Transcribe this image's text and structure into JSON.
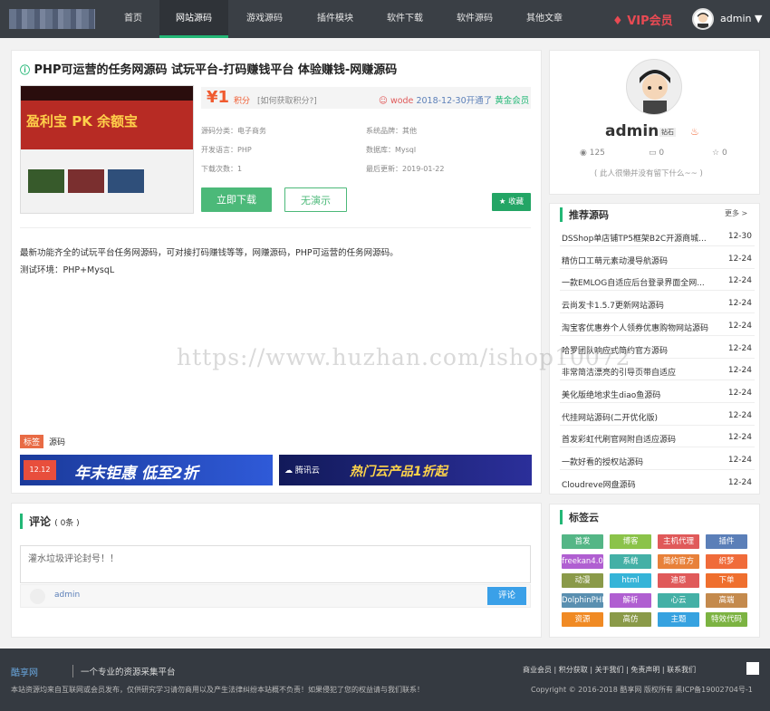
{
  "nav": {
    "items": [
      "首页",
      "网站源码",
      "游戏源码",
      "插件模块",
      "软件下载",
      "软件源码",
      "其他文章"
    ],
    "vip": "VIP会员",
    "user": "admin"
  },
  "product": {
    "title": "PHP可运营的任务网源码 试玩平台-打码赚钱平台 体验赚钱-网赚源码",
    "price": "¥1",
    "price_unit": "积分",
    "price_hint": "[如何获取积分?]",
    "vip_user": "wode",
    "vip_date": "2018-12-30开通了",
    "vip_level": "黄金会员",
    "meta": {
      "category": "源码分类：电子商务",
      "brand": "系统品牌：其他",
      "language": "开发语言：PHP",
      "db": "数据库：Mysql",
      "downloads": "下载次数：1",
      "updated": "最后更新：2019-01-22"
    },
    "download_label": "立即下载",
    "demo_label": "无演示",
    "collect_label": "收藏",
    "desc1": "最新功能齐全的试玩平台任务网源码，可对接打码赚钱等等，网赚源码，PHP可运营的任务网源码。",
    "desc2": "测试环境：PHP+MysqL",
    "tag_label": "标签",
    "tag_value": "源码",
    "thumb_text": "盈利宝 PK 余额宝"
  },
  "banners": [
    {
      "badge": "12.12",
      "text": "年末钜惠 低至2折"
    },
    {
      "brand": "腾讯云",
      "text": "热门云产品1折起"
    }
  ],
  "comments": {
    "heading": "评论",
    "count": "( 0条 )",
    "placeholder": "灌水垃圾评论封号！！",
    "user": "admin",
    "submit": "评论"
  },
  "profile": {
    "name": "admin",
    "badge": "钻石",
    "views": "125",
    "comments": "0",
    "likes": "0",
    "bio": "( 此人很懒并没有留下什么~~ )"
  },
  "recommend": {
    "title": "推荐源码",
    "more": "更多 >",
    "items": [
      {
        "t": "DSShop单店铺TP5框架B2C开源商城...",
        "d": "12-30"
      },
      {
        "t": "精仿口工萌元素动漫导航源码",
        "d": "12-24"
      },
      {
        "t": "一款EMLOG自适应后台登录界面全网...",
        "d": "12-24"
      },
      {
        "t": "云尚发卡1.5.7更新网站源码",
        "d": "12-24"
      },
      {
        "t": "淘宝客优惠券个人领券优惠购物网站源码",
        "d": "12-24"
      },
      {
        "t": "哈罗团队响应式简约官方源码",
        "d": "12-24"
      },
      {
        "t": "非常简洁漂亮的引导页带自适应",
        "d": "12-24"
      },
      {
        "t": "美化版绝地求生diao鱼源码",
        "d": "12-24"
      },
      {
        "t": "代挂网站源码(二开优化版)",
        "d": "12-24"
      },
      {
        "t": "首发彩虹代刷官网附自适应源码",
        "d": "12-24"
      },
      {
        "t": "一款好看的授权站源码",
        "d": "12-24"
      },
      {
        "t": "Cloudreve网盘源码",
        "d": "12-24"
      }
    ]
  },
  "tags": {
    "title": "标签云",
    "items": [
      {
        "t": "首发",
        "c": "#54b686"
      },
      {
        "t": "博客",
        "c": "#8bc34a"
      },
      {
        "t": "主机代理",
        "c": "#e05a5a"
      },
      {
        "t": "插件",
        "c": "#5b7fb8"
      },
      {
        "t": "freekan4.0",
        "c": "#b05fd1"
      },
      {
        "t": "系统",
        "c": "#44b0a6"
      },
      {
        "t": "简约官方",
        "c": "#e8813a"
      },
      {
        "t": "织梦",
        "c": "#f06b3a"
      },
      {
        "t": "动漫",
        "c": "#8a9a49"
      },
      {
        "t": "html",
        "c": "#36b4d8"
      },
      {
        "t": "迪恩",
        "c": "#e05a5a"
      },
      {
        "t": "下单",
        "c": "#ef6f2e"
      },
      {
        "t": "DolphinPHP",
        "c": "#5a8fb0"
      },
      {
        "t": "解析",
        "c": "#b05fd1"
      },
      {
        "t": "心云",
        "c": "#44b0a6"
      },
      {
        "t": "高端",
        "c": "#c48a4d"
      },
      {
        "t": "资源",
        "c": "#f08a24"
      },
      {
        "t": "高仿",
        "c": "#8a9a49"
      },
      {
        "t": "主题",
        "c": "#36a2e0"
      },
      {
        "t": "特效代码",
        "c": "#7cb342"
      }
    ]
  },
  "footer": {
    "logo": "酷享网",
    "slogan": "一个专业的资源采集平台",
    "links": [
      "商业会员",
      "积分获取",
      "关于我们",
      "免责声明",
      "联系我们"
    ],
    "notice": "本站资源均来自互联网或会员发布，仅供研究学习请勿商用以及产生法律纠纷本站概不负责！如果侵犯了您的权益请与我们联系！",
    "copyright": "Copyright © 2016-2018 酷享网 版权所有 黑ICP备19002704号-1"
  },
  "watermark": "https://www.huzhan.com/ishop10072"
}
